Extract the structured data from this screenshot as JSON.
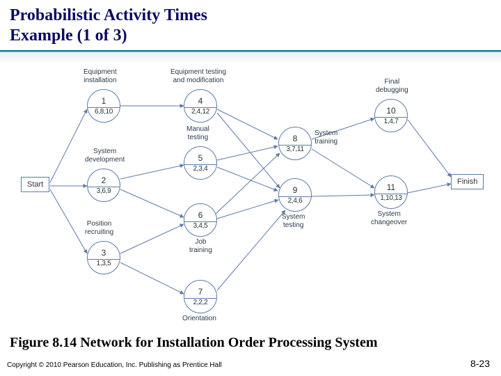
{
  "title": {
    "line1": "Probabilistic Activity Times",
    "line2": "Example (1 of 3)"
  },
  "caption": "Figure 8.14   Network for Installation Order Processing System",
  "footer": "Copyright © 2010 Pearson Education, Inc. Publishing as Prentice Hall",
  "slide_number": "8-23",
  "terminals": {
    "start": "Start",
    "finish": "Finish"
  },
  "activities": {
    "a1": {
      "num": "1",
      "times": "6,8,10",
      "label": "Equipment\ninstallation"
    },
    "a2": {
      "num": "2",
      "times": "3,6,9",
      "label": "System\ndevelopment"
    },
    "a3": {
      "num": "3",
      "times": "1,3,5",
      "label": "Position\nrecruiting"
    },
    "a4": {
      "num": "4",
      "times": "2,4,12",
      "label": "Equipment testing\nand modification"
    },
    "a5": {
      "num": "5",
      "times": "2,3,4",
      "label": "Manual\ntesting"
    },
    "a6": {
      "num": "6",
      "times": "3,4,5",
      "label": "Job\ntraining"
    },
    "a7": {
      "num": "7",
      "times": "2,2,2",
      "label": "Orientation"
    },
    "a8": {
      "num": "8",
      "times": "3,7,11",
      "label": "System\ntraining"
    },
    "a9": {
      "num": "9",
      "times": "2,4,6",
      "label": "System\ntesting"
    },
    "a10": {
      "num": "10",
      "times": "1,4,7",
      "label": "Final\ndebugging"
    },
    "a11": {
      "num": "11",
      "times": "1,10,13",
      "label": "System\nchangeover"
    }
  },
  "chart_data": {
    "type": "diagram",
    "graph": "activity-on-node PERT",
    "nodes": [
      {
        "id": "Start",
        "type": "terminal"
      },
      {
        "id": 1,
        "label": "Equipment installation",
        "optimistic": 6,
        "most_likely": 8,
        "pessimistic": 10
      },
      {
        "id": 2,
        "label": "System development",
        "optimistic": 3,
        "most_likely": 6,
        "pessimistic": 9
      },
      {
        "id": 3,
        "label": "Position recruiting",
        "optimistic": 1,
        "most_likely": 3,
        "pessimistic": 5
      },
      {
        "id": 4,
        "label": "Equipment testing and modification",
        "optimistic": 2,
        "most_likely": 4,
        "pessimistic": 12
      },
      {
        "id": 5,
        "label": "Manual testing",
        "optimistic": 2,
        "most_likely": 3,
        "pessimistic": 4
      },
      {
        "id": 6,
        "label": "Job training",
        "optimistic": 3,
        "most_likely": 4,
        "pessimistic": 5
      },
      {
        "id": 7,
        "label": "Orientation",
        "optimistic": 2,
        "most_likely": 2,
        "pessimistic": 2
      },
      {
        "id": 8,
        "label": "System training",
        "optimistic": 3,
        "most_likely": 7,
        "pessimistic": 11
      },
      {
        "id": 9,
        "label": "System testing",
        "optimistic": 2,
        "most_likely": 4,
        "pessimistic": 6
      },
      {
        "id": 10,
        "label": "Final debugging",
        "optimistic": 1,
        "most_likely": 4,
        "pessimistic": 7
      },
      {
        "id": 11,
        "label": "System changeover",
        "optimistic": 1,
        "most_likely": 10,
        "pessimistic": 13
      },
      {
        "id": "Finish",
        "type": "terminal"
      }
    ],
    "edges": [
      [
        "Start",
        1
      ],
      [
        "Start",
        2
      ],
      [
        "Start",
        3
      ],
      [
        1,
        4
      ],
      [
        2,
        5
      ],
      [
        2,
        6
      ],
      [
        3,
        6
      ],
      [
        3,
        7
      ],
      [
        4,
        8
      ],
      [
        4,
        9
      ],
      [
        5,
        8
      ],
      [
        5,
        9
      ],
      [
        6,
        8
      ],
      [
        6,
        9
      ],
      [
        7,
        9
      ],
      [
        8,
        10
      ],
      [
        8,
        11
      ],
      [
        9,
        11
      ],
      [
        10,
        "Finish"
      ],
      [
        11,
        "Finish"
      ]
    ]
  }
}
